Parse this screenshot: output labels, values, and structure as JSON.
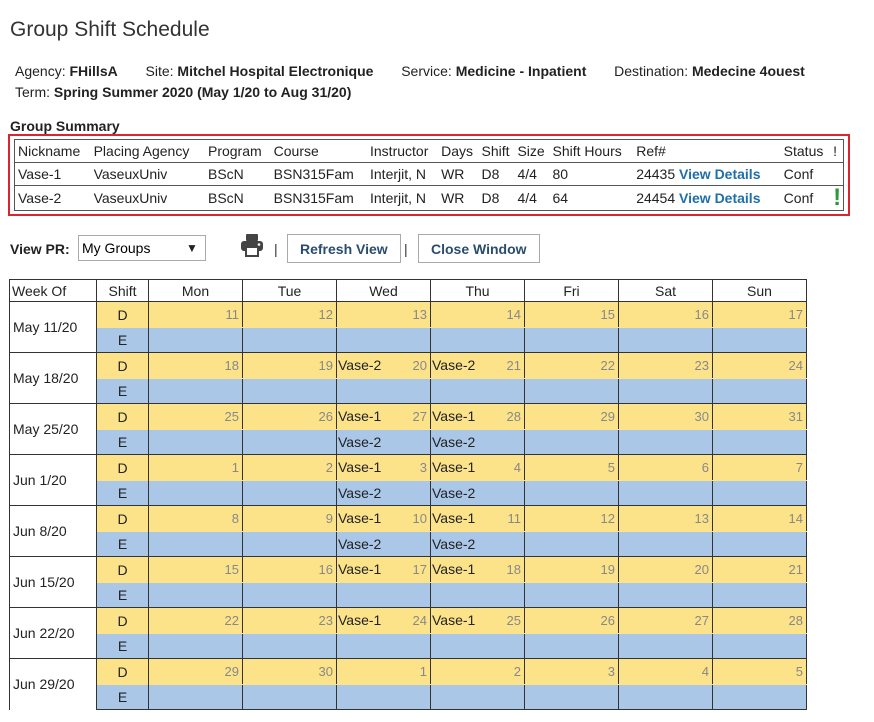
{
  "title": "Group Shift Schedule",
  "info": {
    "agency_label": "Agency:",
    "agency": "FHillsA",
    "site_label": "Site:",
    "site": "Mitchel Hospital Electronique",
    "service_label": "Service:",
    "service": "Medicine - Inpatient",
    "destination_label": "Destination:",
    "destination": "Medecine 4ouest",
    "term_label": "Term:",
    "term": "Spring Summer 2020",
    "term_dates": "(May 1/20 to Aug 31/20)"
  },
  "summary": {
    "title": "Group Summary",
    "headers": [
      "Nickname",
      "Placing Agency",
      "Program",
      "Course",
      "Instructor",
      "Days",
      "Shift",
      "Size",
      "Shift Hours",
      "Ref#",
      "Status",
      "!"
    ],
    "rows": [
      {
        "nickname": "Vase-1",
        "agency": "VaseuxUniv",
        "program": "BScN",
        "course": "BSN315Fam",
        "instructor": "Interjit, N",
        "days": "WR",
        "shift": "D8",
        "size": "4/4",
        "hours": "80",
        "ref": "24435",
        "details": "View Details",
        "status": "Conf",
        "flag": ""
      },
      {
        "nickname": "Vase-2",
        "agency": "VaseuxUniv",
        "program": "BScN",
        "course": "BSN315Fam",
        "instructor": "Interjit, N",
        "days": "WR",
        "shift": "D8",
        "size": "4/4",
        "hours": "64",
        "ref": "24454",
        "details": "View Details",
        "status": "Conf",
        "flag": "!"
      }
    ]
  },
  "controls": {
    "view_label": "View PR:",
    "view_value": "My Groups",
    "refresh_label": "Refresh View",
    "close_label": "Close Window",
    "pipe": "|"
  },
  "colors": {
    "day_shift": "#fce38a",
    "evening_shift": "#aac7e8",
    "link": "#1f6fa8",
    "alert": "#2a9a3a",
    "highlight_border": "#d9262e"
  },
  "schedule": {
    "headers": [
      "Week Of",
      "Shift",
      "Mon",
      "Tue",
      "Wed",
      "Thu",
      "Fri",
      "Sat",
      "Sun"
    ],
    "weeks": [
      {
        "week": "May 11/20",
        "days": [
          "11",
          "12",
          "13",
          "14",
          "15",
          "16",
          "17"
        ],
        "d": [
          "",
          "",
          "",
          "",
          "",
          "",
          ""
        ],
        "e": [
          "",
          "",
          "",
          "",
          "",
          "",
          ""
        ]
      },
      {
        "week": "May 18/20",
        "days": [
          "18",
          "19",
          "20",
          "21",
          "22",
          "23",
          "24"
        ],
        "d": [
          "",
          "",
          "Vase-2",
          "Vase-2",
          "",
          "",
          ""
        ],
        "e": [
          "",
          "",
          "",
          "",
          "",
          "",
          ""
        ]
      },
      {
        "week": "May 25/20",
        "days": [
          "25",
          "26",
          "27",
          "28",
          "29",
          "30",
          "31"
        ],
        "d": [
          "",
          "",
          "Vase-1",
          "Vase-1",
          "",
          "",
          ""
        ],
        "e": [
          "",
          "",
          "Vase-2",
          "Vase-2",
          "",
          "",
          ""
        ]
      },
      {
        "week": "Jun 1/20",
        "days": [
          "1",
          "2",
          "3",
          "4",
          "5",
          "6",
          "7"
        ],
        "d": [
          "",
          "",
          "Vase-1",
          "Vase-1",
          "",
          "",
          ""
        ],
        "e": [
          "",
          "",
          "Vase-2",
          "Vase-2",
          "",
          "",
          ""
        ]
      },
      {
        "week": "Jun 8/20",
        "days": [
          "8",
          "9",
          "10",
          "11",
          "12",
          "13",
          "14"
        ],
        "d": [
          "",
          "",
          "Vase-1",
          "Vase-1",
          "",
          "",
          ""
        ],
        "e": [
          "",
          "",
          "Vase-2",
          "Vase-2",
          "",
          "",
          ""
        ]
      },
      {
        "week": "Jun 15/20",
        "days": [
          "15",
          "16",
          "17",
          "18",
          "19",
          "20",
          "21"
        ],
        "d": [
          "",
          "",
          "Vase-1",
          "Vase-1",
          "",
          "",
          ""
        ],
        "e": [
          "",
          "",
          "",
          "",
          "",
          "",
          ""
        ]
      },
      {
        "week": "Jun 22/20",
        "days": [
          "22",
          "23",
          "24",
          "25",
          "26",
          "27",
          "28"
        ],
        "d": [
          "",
          "",
          "Vase-1",
          "Vase-1",
          "",
          "",
          ""
        ],
        "e": [
          "",
          "",
          "",
          "",
          "",
          "",
          ""
        ]
      },
      {
        "week": "Jun 29/20",
        "days": [
          "29",
          "30",
          "1",
          "2",
          "3",
          "4",
          "5"
        ],
        "d": [
          "",
          "",
          "",
          "",
          "",
          "",
          ""
        ],
        "e": [
          "",
          "",
          "",
          "",
          "",
          "",
          ""
        ]
      }
    ],
    "shift_d": "D",
    "shift_e": "E"
  }
}
